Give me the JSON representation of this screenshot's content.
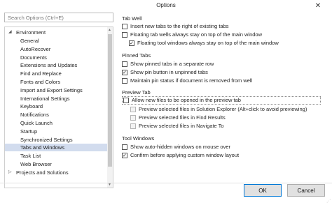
{
  "window": {
    "title": "Options",
    "close_glyph": "✕"
  },
  "search": {
    "placeholder": "Search Options (Ctrl+E)"
  },
  "tree": {
    "items": [
      {
        "label": "Environment",
        "level": 0,
        "expanded": true,
        "selected": false
      },
      {
        "label": "General",
        "level": 1,
        "selected": false
      },
      {
        "label": "AutoRecover",
        "level": 1,
        "selected": false
      },
      {
        "label": "Documents",
        "level": 1,
        "selected": false
      },
      {
        "label": "Extensions and Updates",
        "level": 1,
        "selected": false
      },
      {
        "label": "Find and Replace",
        "level": 1,
        "selected": false
      },
      {
        "label": "Fonts and Colors",
        "level": 1,
        "selected": false
      },
      {
        "label": "Import and Export Settings",
        "level": 1,
        "selected": false
      },
      {
        "label": "International Settings",
        "level": 1,
        "selected": false
      },
      {
        "label": "Keyboard",
        "level": 1,
        "selected": false
      },
      {
        "label": "Notifications",
        "level": 1,
        "selected": false
      },
      {
        "label": "Quick Launch",
        "level": 1,
        "selected": false
      },
      {
        "label": "Startup",
        "level": 1,
        "selected": false
      },
      {
        "label": "Synchronized Settings",
        "level": 1,
        "selected": false
      },
      {
        "label": "Tabs and Windows",
        "level": 1,
        "selected": true
      },
      {
        "label": "Task List",
        "level": 1,
        "selected": false
      },
      {
        "label": "Web Browser",
        "level": 1,
        "selected": false
      },
      {
        "label": "Projects and Solutions",
        "level": 0,
        "expanded": false,
        "selected": false
      }
    ]
  },
  "sections": {
    "tab_well": {
      "heading": "Tab Well",
      "opt1": {
        "label": "Insert new tabs to the right of existing tabs",
        "checked": false
      },
      "opt2": {
        "label": "Floating tab wells always stay on top of the main window",
        "checked": false
      },
      "opt3": {
        "label": "Floating tool windows always stay on top of the main window",
        "checked": true
      }
    },
    "pinned_tabs": {
      "heading": "Pinned Tabs",
      "opt1": {
        "label": "Show pinned tabs in a separate row",
        "checked": false
      },
      "opt2": {
        "label": "Show pin button in unpinned tabs",
        "checked": true
      },
      "opt3": {
        "label": "Maintain pin status if document is removed from well",
        "checked": false
      }
    },
    "preview_tab": {
      "heading": "Preview Tab",
      "opt1": {
        "label": "Allow new files to be opened in the preview tab",
        "checked": false
      },
      "opt2": {
        "label": "Preview selected files in Solution Explorer (Alt+click to avoid previewing)",
        "checked": false
      },
      "opt3": {
        "label": "Preview selected files in Find Results",
        "checked": false
      },
      "opt4": {
        "label": "Preview selected files in Navigate To",
        "checked": false
      }
    },
    "tool_windows": {
      "heading": "Tool Windows",
      "opt1": {
        "label": "Show auto-hidden windows on mouse over",
        "checked": false
      },
      "opt2": {
        "label": "Confirm before applying custom window layout",
        "checked": true
      }
    }
  },
  "buttons": {
    "ok": "OK",
    "cancel": "Cancel"
  },
  "colors": {
    "selection": "#d2dcee",
    "accent": "#0078d7"
  }
}
